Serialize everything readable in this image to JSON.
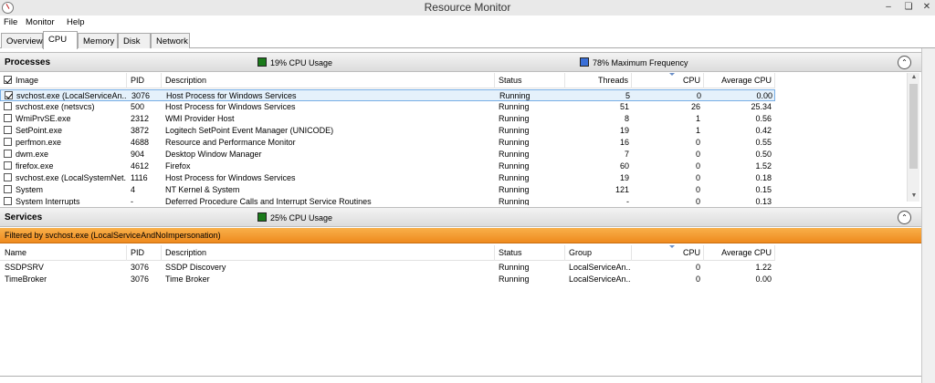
{
  "window": {
    "title": "Resource Monitor"
  },
  "menu": [
    "File",
    "Monitor",
    "Help"
  ],
  "tabs": [
    "Overview",
    "CPU",
    "Memory",
    "Disk",
    "Network"
  ],
  "active_tab": "CPU",
  "processes": {
    "title": "Processes",
    "cpu_usage": "19% CPU Usage",
    "max_freq": "78% Maximum Frequency",
    "usage_color": "#1a7a1a",
    "freq_color": "#3a6fd8",
    "columns": [
      "Image",
      "PID",
      "Description",
      "Status",
      "Threads",
      "CPU",
      "Average CPU"
    ],
    "rows": [
      {
        "image": "svchost.exe (LocalServiceAn...",
        "pid": "3076",
        "desc": "Host Process for Windows Services",
        "status": "Running",
        "threads": "5",
        "cpu": "0",
        "avg": "0.00",
        "checked": true
      },
      {
        "image": "svchost.exe (netsvcs)",
        "pid": "500",
        "desc": "Host Process for Windows Services",
        "status": "Running",
        "threads": "51",
        "cpu": "26",
        "avg": "25.34",
        "checked": false
      },
      {
        "image": "WmiPrvSE.exe",
        "pid": "2312",
        "desc": "WMI Provider Host",
        "status": "Running",
        "threads": "8",
        "cpu": "1",
        "avg": "0.56",
        "checked": false
      },
      {
        "image": "SetPoint.exe",
        "pid": "3872",
        "desc": "Logitech SetPoint Event Manager (UNICODE)",
        "status": "Running",
        "threads": "19",
        "cpu": "1",
        "avg": "0.42",
        "checked": false
      },
      {
        "image": "perfmon.exe",
        "pid": "4688",
        "desc": "Resource and Performance Monitor",
        "status": "Running",
        "threads": "16",
        "cpu": "0",
        "avg": "0.55",
        "checked": false
      },
      {
        "image": "dwm.exe",
        "pid": "904",
        "desc": "Desktop Window Manager",
        "status": "Running",
        "threads": "7",
        "cpu": "0",
        "avg": "0.50",
        "checked": false
      },
      {
        "image": "firefox.exe",
        "pid": "4612",
        "desc": "Firefox",
        "status": "Running",
        "threads": "60",
        "cpu": "0",
        "avg": "1.52",
        "checked": false
      },
      {
        "image": "svchost.exe (LocalSystemNet...",
        "pid": "1116",
        "desc": "Host Process for Windows Services",
        "status": "Running",
        "threads": "19",
        "cpu": "0",
        "avg": "0.18",
        "checked": false
      },
      {
        "image": "System",
        "pid": "4",
        "desc": "NT Kernel & System",
        "status": "Running",
        "threads": "121",
        "cpu": "0",
        "avg": "0.15",
        "checked": false
      },
      {
        "image": "System Interrupts",
        "pid": "-",
        "desc": "Deferred Procedure Calls and Interrupt Service Routines",
        "status": "Running",
        "threads": "-",
        "cpu": "0",
        "avg": "0.13",
        "checked": false
      }
    ]
  },
  "services": {
    "title": "Services",
    "cpu_usage": "25% CPU Usage",
    "usage_color": "#1a7a1a",
    "filter": "Filtered by svchost.exe (LocalServiceAndNoImpersonation)",
    "columns": [
      "Name",
      "PID",
      "Description",
      "Status",
      "Group",
      "CPU",
      "Average CPU"
    ],
    "rows": [
      {
        "name": "SSDPSRV",
        "pid": "3076",
        "desc": "SSDP Discovery",
        "status": "Running",
        "group": "LocalServiceAn...",
        "cpu": "0",
        "avg": "1.22"
      },
      {
        "name": "TimeBroker",
        "pid": "3076",
        "desc": "Time Broker",
        "status": "Running",
        "group": "LocalServiceAn...",
        "cpu": "0",
        "avg": "0.00"
      }
    ]
  }
}
